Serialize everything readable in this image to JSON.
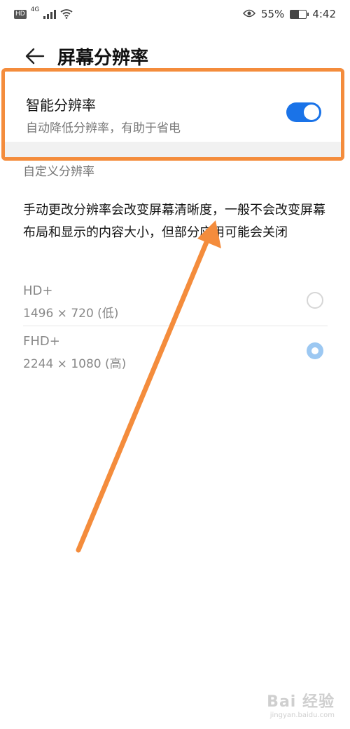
{
  "status_bar": {
    "left_badges": [
      "HD",
      "4G"
    ],
    "battery_percent": "55%",
    "time": "4:42"
  },
  "header": {
    "title": "屏幕分辨率"
  },
  "smart_resolution": {
    "title": "智能分辨率",
    "subtitle": "自动降低分辨率，有助于省电",
    "enabled": true
  },
  "custom": {
    "section_label": "自定义分辨率",
    "description": "手动更改分辨率会改变屏幕清晰度，一般不会改变屏幕布局和显示的内容大小，但部分应用可能会关闭",
    "options": [
      {
        "name": "HD+",
        "value": "1496 × 720 (低)",
        "selected": false
      },
      {
        "name": "FHD+",
        "value": "2244 × 1080 (高)",
        "selected": true
      }
    ]
  },
  "watermark": {
    "logo": "Bai 经验",
    "url": "jingyan.baidu.com"
  },
  "colors": {
    "accent": "#1a73e8",
    "highlight": "#f48c3c"
  }
}
